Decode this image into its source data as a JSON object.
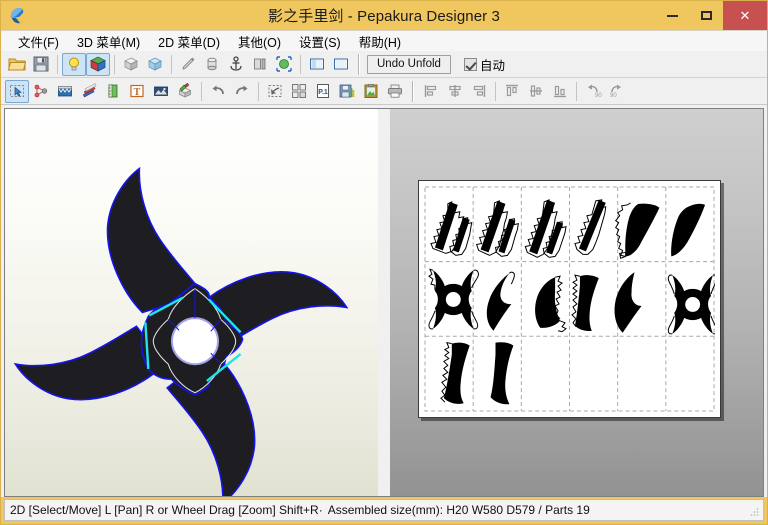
{
  "window": {
    "title": "影之手里剑 - Pepakura Designer 3",
    "app_icon": "pepakura-app-icon",
    "controls": {
      "minimize": "minimize-icon",
      "maximize": "maximize-icon",
      "close": "✕"
    },
    "accent_titlebar": "#efc75e",
    "accent_close": "#c75050"
  },
  "menubar": {
    "items": [
      {
        "label": "文件(F)",
        "name": "menu-file"
      },
      {
        "label": "3D 菜单(M)",
        "name": "menu-3d"
      },
      {
        "label": "2D 菜单(D)",
        "name": "menu-2d"
      },
      {
        "label": "其他(O)",
        "name": "menu-other"
      },
      {
        "label": "设置(S)",
        "name": "menu-settings"
      },
      {
        "label": "帮助(H)",
        "name": "menu-help"
      }
    ]
  },
  "toolbar_main": {
    "undo_unfold_label": "Undo Unfold",
    "auto_label": "自动",
    "auto_checked": true,
    "buttons": [
      {
        "name": "open-file-icon",
        "active": false
      },
      {
        "name": "save-file-icon",
        "active": false
      },
      {
        "name": "light-bulb-icon",
        "active": true
      },
      {
        "name": "texture-cube-icon",
        "active": true
      },
      {
        "name": "flat-shading-cube-icon",
        "active": false
      },
      {
        "name": "wireframe-cube-icon",
        "active": false
      },
      {
        "name": "pencil-edit-icon",
        "active": false
      },
      {
        "name": "cylinder-icon",
        "active": false
      },
      {
        "name": "anchor-icon",
        "active": false
      },
      {
        "name": "mirror-icon",
        "active": false
      },
      {
        "name": "select-globe-icon",
        "active": false
      },
      {
        "name": "split-horizontal-icon",
        "active": false
      },
      {
        "name": "single-pane-icon",
        "active": false
      }
    ]
  },
  "toolbar_second": {
    "buttons": [
      {
        "name": "select-move-icon",
        "active": true
      },
      {
        "name": "join-disjoin-icon",
        "active": false
      },
      {
        "name": "cut-edge-icon",
        "active": false
      },
      {
        "name": "flap-edit-icon",
        "active": false
      },
      {
        "name": "scale-measure-icon",
        "active": false
      },
      {
        "name": "add-text-icon",
        "active": false
      },
      {
        "name": "add-image-icon",
        "active": false
      },
      {
        "name": "paint-cube-icon",
        "active": false
      },
      {
        "name": "undo-icon",
        "active": false
      },
      {
        "name": "redo-icon",
        "active": false
      },
      {
        "name": "select-all-icon",
        "active": false
      },
      {
        "name": "layout-parts-icon",
        "active": false
      },
      {
        "name": "page-setup-icon",
        "active": false
      },
      {
        "name": "export-icon",
        "active": false
      },
      {
        "name": "copy-clipboard-icon",
        "active": false
      },
      {
        "name": "print-icon",
        "active": false
      },
      {
        "name": "align-left-icon",
        "active": false
      },
      {
        "name": "align-center-h-icon",
        "active": false
      },
      {
        "name": "align-right-icon",
        "active": false
      },
      {
        "name": "align-top-icon",
        "active": false
      },
      {
        "name": "align-middle-v-icon",
        "active": false
      },
      {
        "name": "align-bottom-icon",
        "active": false
      },
      {
        "name": "rotate-ccw-90-icon",
        "active": false
      },
      {
        "name": "rotate-cw-90-icon",
        "active": false
      }
    ]
  },
  "panel_3d": {
    "name": "3d-viewport",
    "model": "four-blade-shuriken",
    "model_fill": "#1d1d22",
    "edge_color": "#1414f0",
    "highlight_edge_color": "#22e4e4"
  },
  "panel_2d": {
    "name": "2d-unfold-viewport",
    "page_background": "#ffffff",
    "guide_color": "#a8a8a8",
    "part_fill": "#000000",
    "grid_cols": 6,
    "grid_rows": 3,
    "parts_on_page": 14
  },
  "statusbar": {
    "hint": "2D [Select/Move] L [Pan] R or Wheel Drag [Zoom] Shift+R",
    "separator": "·",
    "assembled": "Assembled size(mm): H20 W580 D579 / Parts 19"
  }
}
